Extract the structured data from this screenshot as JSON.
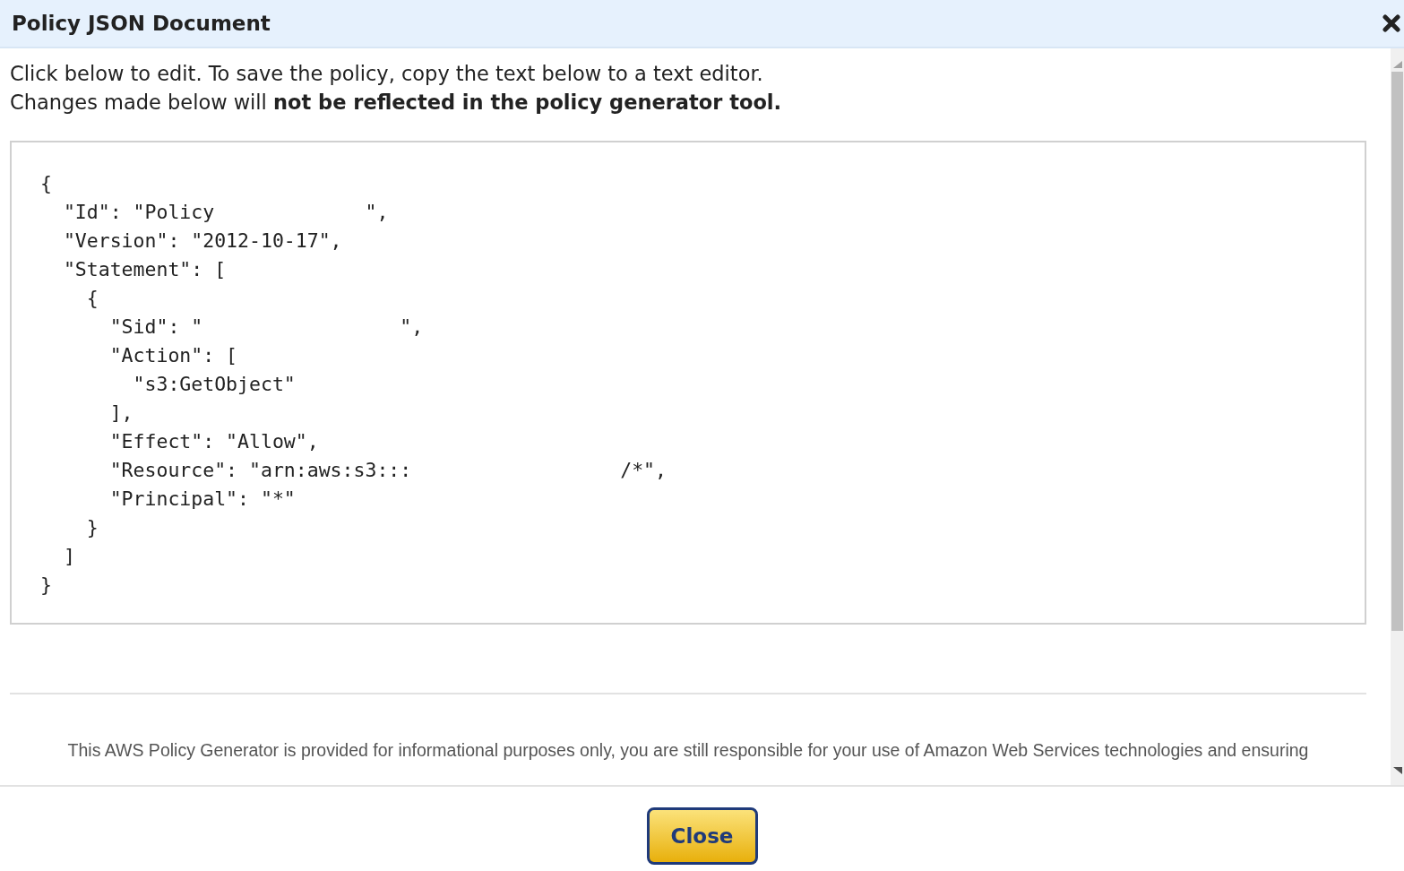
{
  "dialog": {
    "title": "Policy JSON Document",
    "instructions": [
      "Click below to edit. To save the policy, copy the text below to a text editor.",
      "Changes made below will **not be reflected in the policy generator tool.**"
    ],
    "policy_text": "{\n  \"Id\": \"Policy             \",\n  \"Version\": \"2012-10-17\",\n  \"Statement\": [\n    {\n      \"Sid\": \"                 \",\n      \"Action\": [\n        \"s3:GetObject\"\n      ],\n      \"Effect\": \"Allow\",\n      \"Resource\": \"arn:aws:s3:::                  /*\",\n      \"Principal\": \"*\"\n    }\n  ]\n}",
    "disclaimer": "This AWS Policy Generator is provided for informational purposes only, you are still responsible for your use of Amazon Web Services technologies and ensuring",
    "buttons": [
      {
        "label": "Close"
      }
    ]
  }
}
